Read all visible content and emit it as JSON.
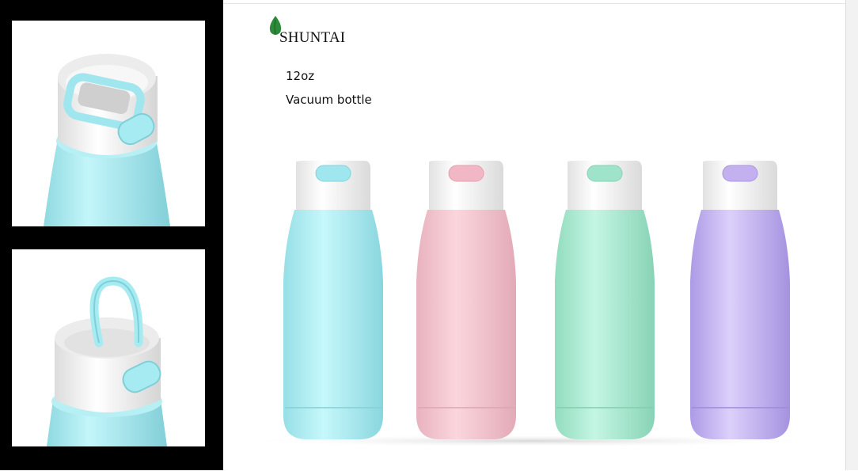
{
  "brand": {
    "name": "SHUNTAI",
    "leaf_color": "#2d8a3a"
  },
  "product": {
    "capacity": "12oz",
    "type": "Vacuum bottle"
  },
  "colors": {
    "cap": "#f4f4f4",
    "variants": [
      {
        "name": "aqua",
        "body": "#aeeef2",
        "accent": "#9fe6ee"
      },
      {
        "name": "pink",
        "body": "#f4c7d0",
        "accent": "#f2b7c4"
      },
      {
        "name": "mint",
        "body": "#a9ecd2",
        "accent": "#9fe3cb"
      },
      {
        "name": "lavender",
        "body": "#c8b8f2",
        "accent": "#c2b0ef"
      }
    ]
  }
}
